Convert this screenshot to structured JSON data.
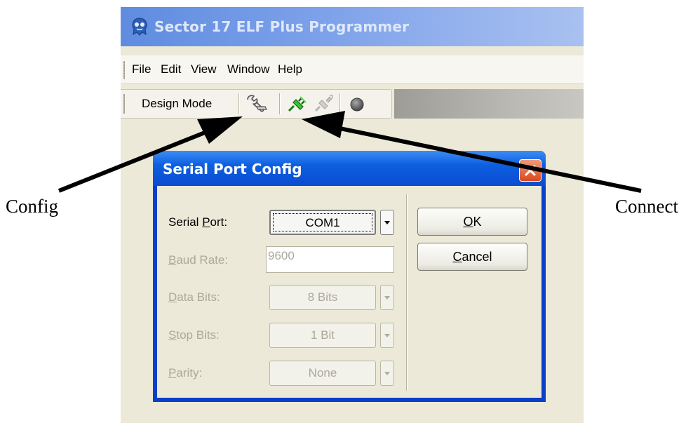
{
  "window": {
    "title": "Sector 17 ELF Plus Programmer"
  },
  "menubar": {
    "items": [
      "File",
      "Edit",
      "View",
      "Window",
      "Help"
    ]
  },
  "toolbar": {
    "mode_label": "Design Mode"
  },
  "dialog": {
    "title": "Serial Port Config",
    "fields": [
      {
        "label": "Serial Port:",
        "mnemonic": "P",
        "value": "COM1",
        "enabled": true
      },
      {
        "label": "Baud Rate:",
        "mnemonic": "B",
        "value": "9600",
        "enabled": false
      },
      {
        "label": "Data Bits:",
        "mnemonic": "D",
        "value": "8 Bits",
        "enabled": false
      },
      {
        "label": "Stop Bits:",
        "mnemonic": "S",
        "value": "1 Bit",
        "enabled": false
      },
      {
        "label": "Parity:",
        "mnemonic": "P",
        "value": "None",
        "enabled": false
      }
    ],
    "ok_label": "OK",
    "cancel_label": "Cancel"
  },
  "annotations": {
    "config": "Config",
    "connect": "Connect"
  }
}
